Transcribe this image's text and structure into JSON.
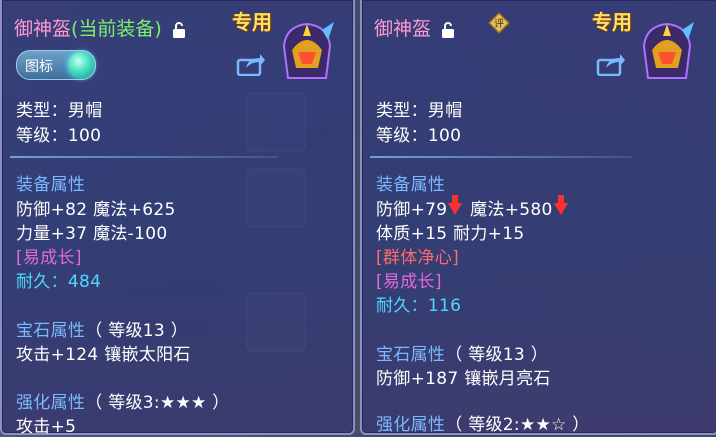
{
  "left": {
    "item_name": "御神盔",
    "equipped_tag": "(当前装备)",
    "special_label": "专用",
    "toggle_label": "图标",
    "type_line": "类型：男帽",
    "level_line": "等级：100",
    "equip_attr_title": "装备属性",
    "attr_line1": "防御+82 魔法+625",
    "attr_line2": "力量+37 魔法-100",
    "growth_tag": "[易成长]",
    "durability": "耐久：484",
    "gem_title": "宝石属性",
    "gem_level": "（ 等级13 ）",
    "gem_line": "攻击+124 镶嵌太阳石",
    "enhance_title": "强化属性",
    "enhance_level": "（ 等级3:★★★ ）",
    "enhance_line": "攻击+5"
  },
  "right": {
    "item_name": "御神盔",
    "eval_label": "评",
    "special_label": "专用",
    "type_line": "类型：男帽",
    "level_line": "等级：100",
    "equip_attr_title": "装备属性",
    "def": "防御+79",
    "magic": "魔法+580",
    "attr_line2": "体质+15 耐力+15",
    "skill_tag": "[群体净心]",
    "growth_tag": "[易成长]",
    "durability": "耐久：116",
    "gem_title": "宝石属性",
    "gem_level": "（ 等级13 ）",
    "gem_line": "防御+187 镶嵌月亮石",
    "enhance_title": "强化属性",
    "enhance_level": "（ 等级2:★★☆ ）"
  },
  "colors": {
    "title": "#ff9ad0",
    "equipped": "#7cf06a",
    "section": "#7ab8ff",
    "tag": "#e06ad8",
    "durability": "#4fd8ff",
    "skill": "#ff6a6a",
    "decrease_arrow": "#ff3030",
    "special": "#ffe066"
  },
  "icons": [
    "lock-open-icon",
    "helmet-icon",
    "share-icon",
    "evaluate-badge-icon",
    "arrow-down-icon"
  ]
}
